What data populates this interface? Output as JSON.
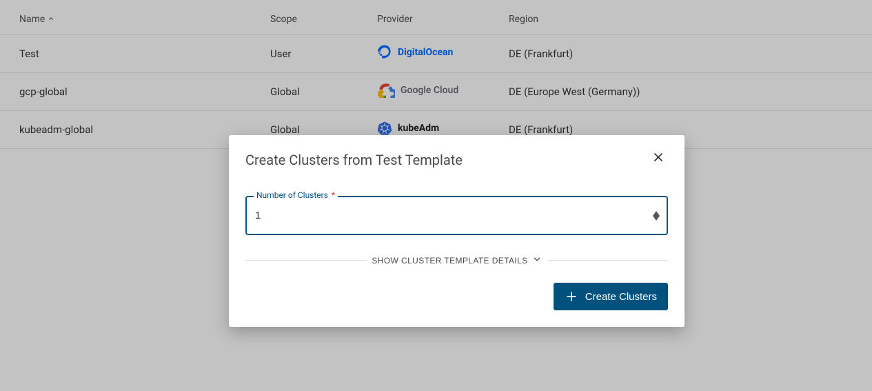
{
  "table": {
    "headers": {
      "name": "Name",
      "scope": "Scope",
      "provider": "Provider",
      "region": "Region"
    },
    "rows": [
      {
        "name": "Test",
        "scope": "User",
        "provider_key": "digitalocean",
        "provider_label": "DigitalOcean",
        "region": "DE (Frankfurt)"
      },
      {
        "name": "gcp-global",
        "scope": "Global",
        "provider_key": "google",
        "provider_label": "Google Cloud",
        "region": "DE (Europe West (Germany))"
      },
      {
        "name": "kubeadm-global",
        "scope": "Global",
        "provider_key": "kubeadm",
        "provider_label": "kubeAdm",
        "region": "DE (Frankfurt)"
      }
    ]
  },
  "modal": {
    "title": "Create Clusters from Test Template",
    "field_label": "Number of Clusters",
    "field_required_marker": "*",
    "field_value": "1",
    "details_toggle": "SHOW CLUSTER TEMPLATE DETAILS",
    "primary_button": "Create Clusters"
  },
  "icons": {
    "sort_asc": "chevron-up-icon",
    "close": "close-icon",
    "chevron_down": "chevron-down-icon",
    "plus": "plus-icon",
    "stepper_up": "stepper-up-icon",
    "stepper_down": "stepper-down-icon"
  },
  "colors": {
    "accent": "#00517d",
    "digitalocean_blue": "#0069ff",
    "google_text": "#5f6368",
    "text": "#4a4a4a"
  }
}
